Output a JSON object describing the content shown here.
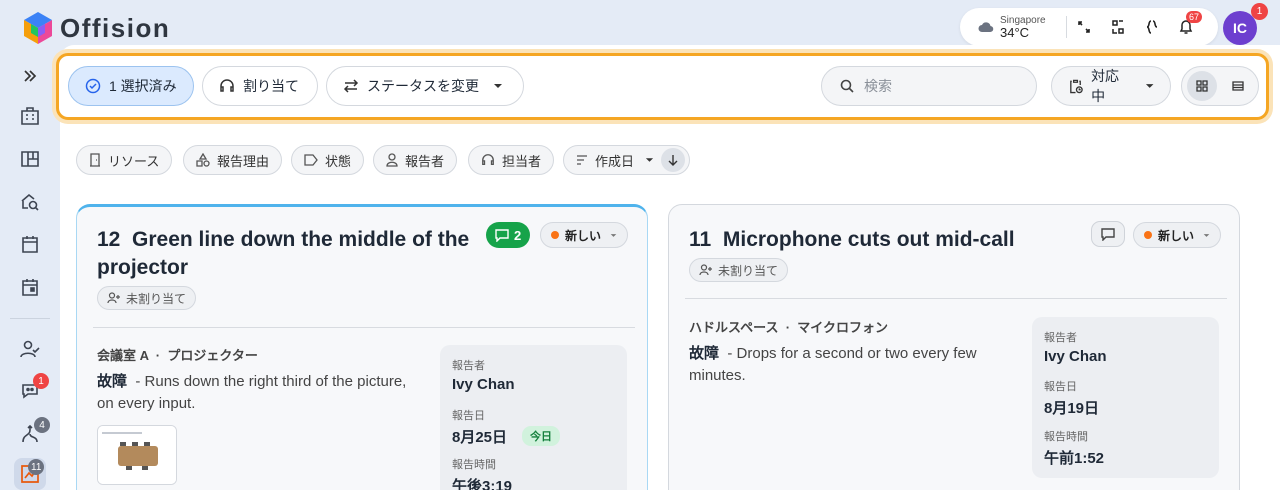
{
  "app": {
    "name": "Offision"
  },
  "header": {
    "weather": {
      "city": "Singapore",
      "temp": "34°C",
      "icon": "cloud-icon"
    },
    "notifications_count": "67",
    "avatar_initials": "IC",
    "avatar_badge": "1"
  },
  "sidebar": {
    "badges": {
      "chat": "1",
      "routes": "4",
      "reports": "11"
    }
  },
  "toolbar": {
    "selected_label": "1 選択済み",
    "assign_label": "割り当て",
    "change_status_label": "ステータスを変更",
    "search_placeholder": "検索",
    "status_filter_label": "対応中"
  },
  "filters": {
    "resource": "リソース",
    "reason": "報告理由",
    "state": "状態",
    "reporter": "報告者",
    "assignee": "担当者",
    "sort_label": "作成日"
  },
  "cards": [
    {
      "number": "12",
      "title_line1": "Green line down the middle of",
      "title_line2": "the projector",
      "assignee": "未割り当て",
      "comment_count": "2",
      "status": "新しい",
      "location_room": "会議室 A",
      "location_sep": "·",
      "location_item": "プロジェクター",
      "issue_type": "故障",
      "description": "- Runs down the right third of the picture, on every input.",
      "reporter_label": "報告者",
      "reporter": "Ivy Chan",
      "date_label": "報告日",
      "date": "8月25日",
      "today_badge": "今日",
      "time_label": "報告時間",
      "time": "午後3:19"
    },
    {
      "number": "11",
      "title_line1": "Microphone cuts out mid-call",
      "assignee": "未割り当て",
      "status": "新しい",
      "location_room": "ハドルスペース",
      "location_sep": "·",
      "location_item": "マイクロフォン",
      "issue_type": "故障",
      "description": "- Drops for a second or two every few minutes.",
      "reporter_label": "報告者",
      "reporter": "Ivy Chan",
      "date_label": "報告日",
      "date": "8月19日",
      "time_label": "報告時間",
      "time": "午前1:52"
    }
  ],
  "colors": {
    "accent": "#f5a623",
    "brand": "#6d3fcf",
    "status_new": "#f97316",
    "success": "#16a34a"
  }
}
